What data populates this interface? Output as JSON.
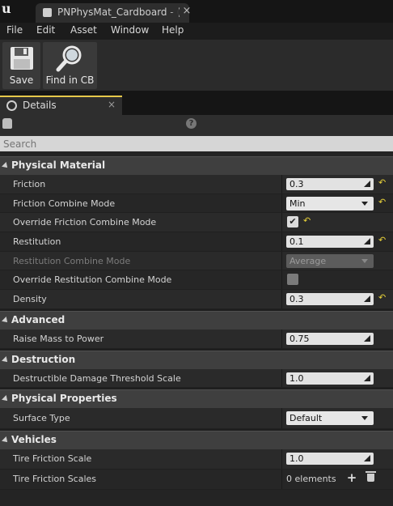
{
  "window": {
    "tab_title": "PNPhysMat_Cardboard - ("
  },
  "menu": [
    "File",
    "Edit",
    "Asset",
    "Window",
    "Help"
  ],
  "toolbar": {
    "save_label": "Save",
    "find_label": "Find in CB"
  },
  "panel": {
    "tab_label": "Details",
    "search_placeholder": "Search"
  },
  "categories": {
    "physical_material": {
      "title": "Physical Material",
      "friction": {
        "label": "Friction",
        "value": "0.3"
      },
      "friction_combine_mode": {
        "label": "Friction Combine Mode",
        "value": "Min"
      },
      "override_friction_combine_mode": {
        "label": "Override Friction Combine Mode",
        "checked": true
      },
      "restitution": {
        "label": "Restitution",
        "value": "0.1"
      },
      "restitution_combine_mode": {
        "label": "Restitution Combine Mode",
        "value": "Average"
      },
      "override_restitution_combine_mode": {
        "label": "Override Restitution Combine Mode",
        "checked": false
      },
      "density": {
        "label": "Density",
        "value": "0.3"
      }
    },
    "advanced": {
      "title": "Advanced",
      "raise_mass_to_power": {
        "label": "Raise Mass to Power",
        "value": "0.75"
      }
    },
    "destruction": {
      "title": "Destruction",
      "destructible_damage_threshold_scale": {
        "label": "Destructible Damage Threshold Scale",
        "value": "1.0"
      }
    },
    "physical_properties": {
      "title": "Physical Properties",
      "surface_type": {
        "label": "Surface Type",
        "value": "Default"
      }
    },
    "vehicles": {
      "title": "Vehicles",
      "tire_friction_scale": {
        "label": "Tire Friction Scale",
        "value": "1.0"
      },
      "tire_friction_scales": {
        "label": "Tire Friction Scales",
        "value": "0 elements"
      }
    }
  },
  "icons": {
    "logo": "unreal-logo-icon",
    "reset": "reset-to-default-icon",
    "colors": {
      "accent": "#e6c84a",
      "reset_arrow": "#e8d23a"
    }
  }
}
